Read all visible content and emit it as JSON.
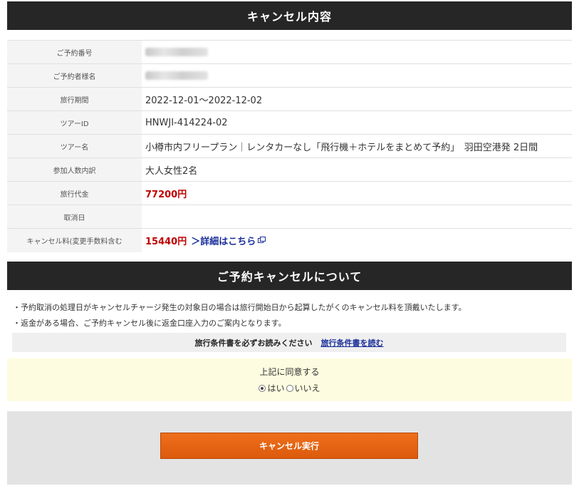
{
  "cancel_details": {
    "header": "キャンセル内容",
    "rows": [
      {
        "label": "ご予約番号",
        "value": ""
      },
      {
        "label": "ご予約者様名",
        "value": ""
      },
      {
        "label": "旅行期間",
        "value": "2022-12-01～2022-12-02"
      },
      {
        "label": "ツアーID",
        "value": "HNWJI-414224-02"
      },
      {
        "label": "ツアー名",
        "value": "小樽市内フリープラン｜レンタカーなし「飛行機＋ホテルをまとめて予約」　羽田空港発 2日間"
      },
      {
        "label": "参加人数内訳",
        "value": "大人女性2名"
      },
      {
        "label": "旅行代金",
        "value": "77200円"
      },
      {
        "label": "取消日",
        "value": ""
      },
      {
        "label": "キャンセル料(変更手数料含む",
        "value": "15440円",
        "link": "＞詳細はこちら"
      }
    ]
  },
  "about": {
    "header": "ご予約キャンセルについて",
    "notes": [
      "・予約取消の処理日がキャンセルチャージ発生の対象日の場合は旅行開始日から起算したがくのキャンセル料を頂戴いたします。",
      "・返金がある場合、ご予約キャンセル後に返金口座入力のご案内となります。"
    ]
  },
  "terms": {
    "text": "旅行条件書を必ずお読みください",
    "link": "旅行条件書を読む"
  },
  "agreement": {
    "question": "上記に同意する",
    "options": [
      {
        "label": "はい",
        "selected": true
      },
      {
        "label": "いいえ",
        "selected": false
      }
    ]
  },
  "action": {
    "execute_label": "キャンセル実行"
  },
  "colors": {
    "header_bg": "#262626",
    "price": "#c00000",
    "link": "#1a2f9a",
    "agree_bg": "#fdfce0",
    "button": "#e0600f"
  }
}
